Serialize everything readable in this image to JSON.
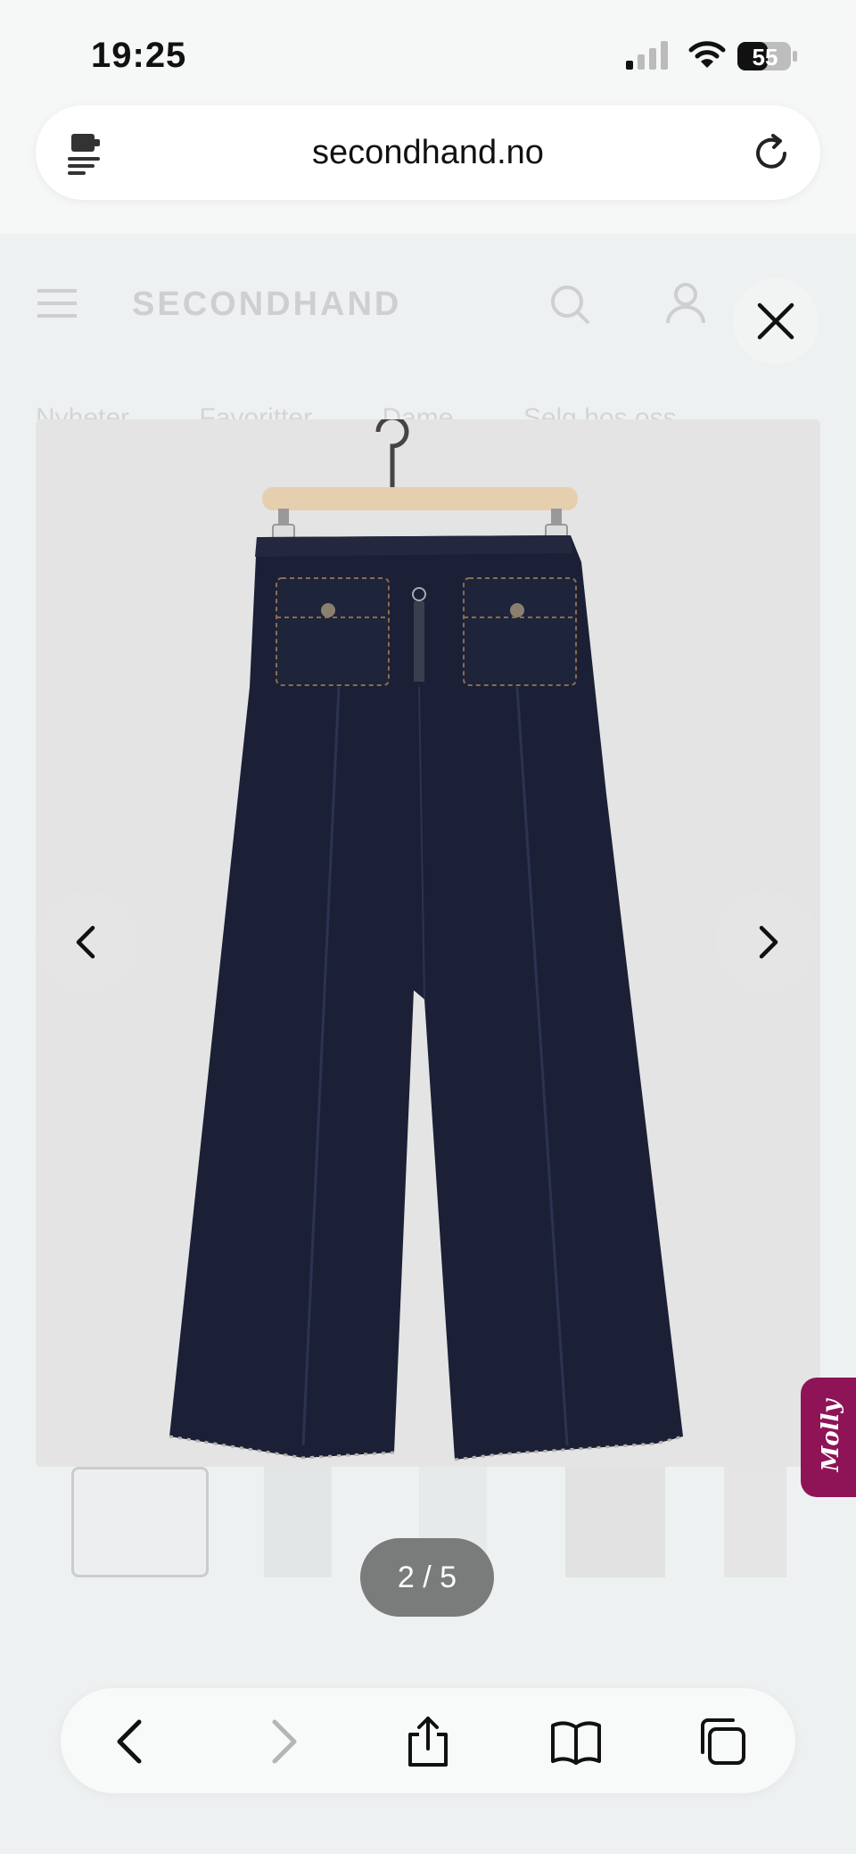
{
  "status_bar": {
    "time": "19:25",
    "battery": "55"
  },
  "browser": {
    "url": "secondhand.no"
  },
  "site": {
    "brand": "SECONDHAND",
    "nav": [
      "Nyheter",
      "Favoritter",
      "Dame",
      "Selg hos oss"
    ]
  },
  "gallery": {
    "counter": "2 / 5"
  },
  "chat_widget": {
    "label": "Molly"
  },
  "colors": {
    "accent": "#8e1457",
    "denim": "#1b2036",
    "counter_bg": "#7a7b7b"
  },
  "icons": {
    "close": "close-icon",
    "prev": "chevron-left-icon",
    "next": "chevron-right-icon",
    "back": "back-icon",
    "forward": "forward-icon",
    "share": "share-icon",
    "bookmarks": "bookmarks-icon",
    "tabs": "tabs-icon"
  }
}
